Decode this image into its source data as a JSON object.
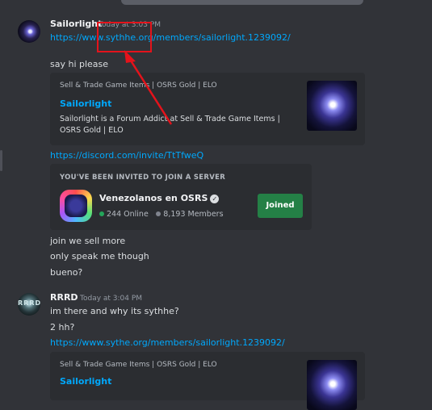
{
  "messages": [
    {
      "author": "Sailorlight",
      "timestamp": "Today at 3:03 PM",
      "lines": [
        "https://www.sythhe.org/members/sailorlight.1239092/",
        "say hi please"
      ],
      "embed": {
        "provider": "Sell & Trade Game Items | OSRS Gold | ELO",
        "title": "Sailorlight",
        "description": "Sailorlight is a Forum Addict at Sell & Trade Game Items | OSRS Gold | ELO"
      },
      "link2": "https://discord.com/invite/TtTfweQ",
      "invite": {
        "header": "YOU'VE BEEN INVITED TO JOIN A SERVER",
        "server_name": "Venezolanos en OSRS",
        "online": "244 Online",
        "members": "8,193 Members",
        "button": "Joined"
      },
      "after_lines": [
        "join we sell more",
        "only speak me though",
        "bueno?"
      ]
    },
    {
      "author": "RRRD",
      "timestamp": "Today at 3:04 PM",
      "lines": [
        "im there and why its sythhe?",
        "2 hh?"
      ],
      "link": "https://www.sythe.org/members/sailorlight.1239092/",
      "embed": {
        "provider": "Sell & Trade Game Items | OSRS Gold | ELO",
        "title": "Sailorlight"
      }
    }
  ],
  "colors": {
    "background": "#313338",
    "link": "#00a8fc",
    "joined_button": "#248046",
    "annotation": "#e4131b"
  },
  "icons": [
    "verified-badge-icon",
    "online-dot-icon",
    "members-dot-icon"
  ]
}
